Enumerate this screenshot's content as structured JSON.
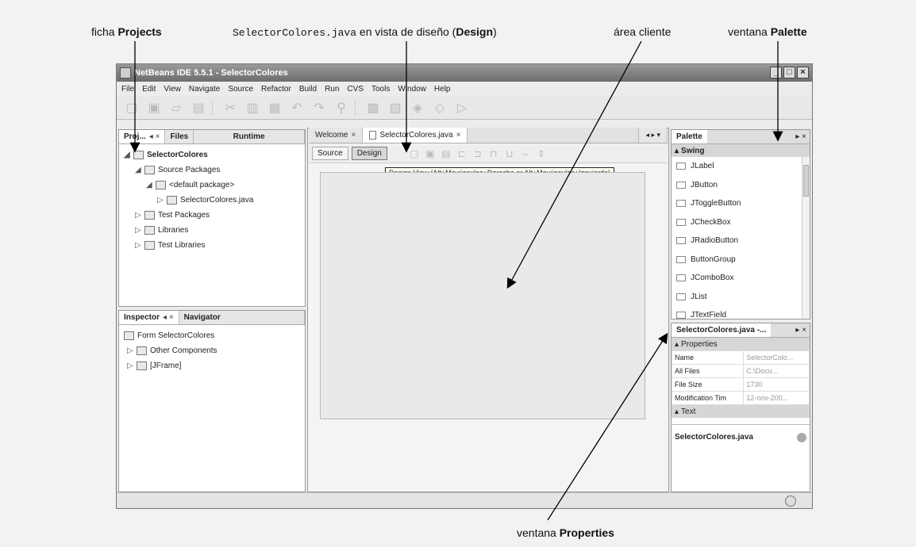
{
  "annotations": {
    "projects_tab_label": {
      "prefix": "ficha ",
      "bold": "Projects"
    },
    "design_view_label": {
      "mono": "SelectorColores.java",
      "middle": " en vista de diseño (",
      "bold": "Design",
      "suffix": ")"
    },
    "client_area_label": "área cliente",
    "palette_label": {
      "prefix": "ventana ",
      "bold": "Palette"
    },
    "properties_label": {
      "prefix": "ventana ",
      "bold": "Properties"
    }
  },
  "window": {
    "title": "NetBeans IDE 5.5.1 - SelectorColores",
    "menu": [
      "File",
      "Edit",
      "View",
      "Navigate",
      "Source",
      "Refactor",
      "Build",
      "Run",
      "CVS",
      "Tools",
      "Window",
      "Help"
    ]
  },
  "projects_panel": {
    "tabs": [
      "Proj...",
      "Files",
      "Runtime"
    ],
    "close": "×",
    "tree": [
      {
        "label": "SelectorColores",
        "bold": true
      },
      {
        "label": "Source Packages"
      },
      {
        "label": "<default package>"
      },
      {
        "label": "SelectorColores.java"
      },
      {
        "label": "Test Packages"
      },
      {
        "label": "Libraries"
      },
      {
        "label": "Test Libraries"
      }
    ]
  },
  "inspector_panel": {
    "tabs": [
      "Inspector",
      "Navigator"
    ],
    "tree": [
      {
        "label": "Form SelectorColores"
      },
      {
        "label": "Other Components"
      },
      {
        "label": "[JFrame]"
      }
    ]
  },
  "editor": {
    "tabs": [
      "Welcome",
      "SelectorColores.java"
    ],
    "source_button": "Source",
    "design_button": "Design",
    "tooltip": "Design View (Alt+Mayúsculas+Derecha or Alt+Mayúsculas+Izquierda)"
  },
  "palette_panel": {
    "title": "Palette",
    "section": "Swing",
    "items": [
      "JLabel",
      "JButton",
      "JToggleButton",
      "JCheckBox",
      "JRadioButton",
      "ButtonGroup",
      "JComboBox",
      "JList",
      "JTextField"
    ]
  },
  "properties_panel": {
    "title": "SelectorColores.java -...",
    "section": "Properties",
    "rows": [
      {
        "name": "Name",
        "value": "SelectorColo..."
      },
      {
        "name": "All Files",
        "value": "C:\\Docu..."
      },
      {
        "name": "File Size",
        "value": "1730"
      },
      {
        "name": "Modification Tim",
        "value": "12-nov-200..."
      }
    ],
    "section2": "Text",
    "footer": "SelectorColores.java"
  }
}
